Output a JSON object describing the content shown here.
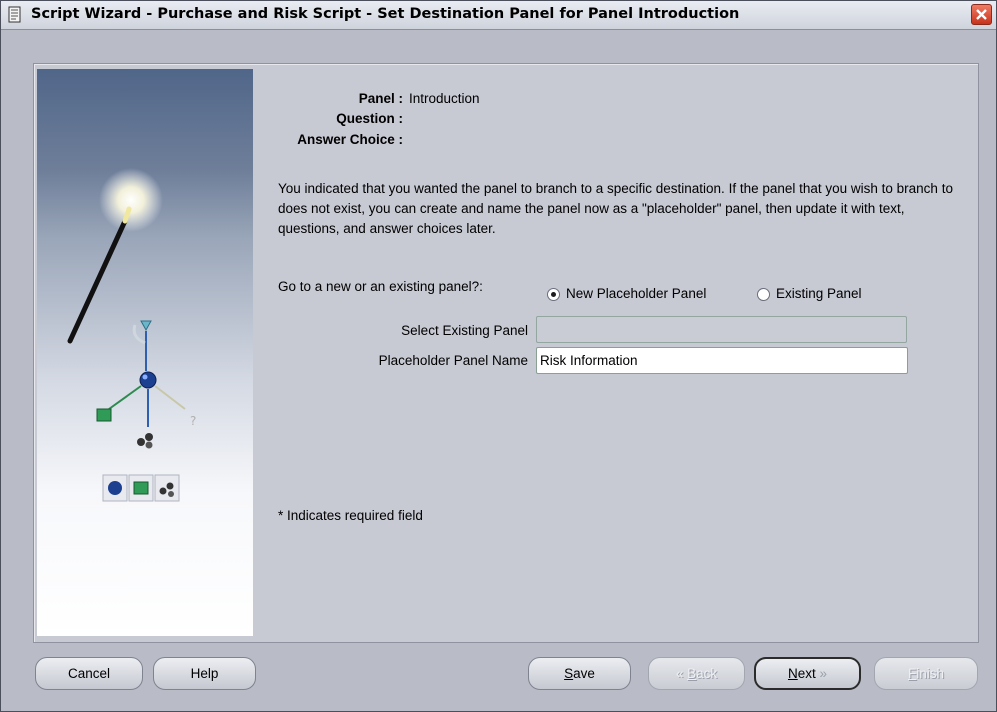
{
  "window": {
    "title": "Script Wizard - Purchase and Risk Script - Set Destination Panel for Panel Introduction"
  },
  "info": {
    "panel_label": "Panel :",
    "panel_value": "Introduction",
    "question_label": "Question :",
    "answer_choice_label": "Answer Choice :"
  },
  "description": "You indicated that you wanted the panel to branch to a specific destination. If the panel that you wish to branch to does not exist, you can create and name the panel now as a \"placeholder\" panel, then update it with text, questions, and answer choices later.",
  "destination": {
    "prompt": "Go to a new or an existing panel?:",
    "option_new": "New Placeholder Panel",
    "option_existing": "Existing Panel",
    "selected": "New Placeholder Panel"
  },
  "fields": {
    "select_existing_label": "Select Existing Panel",
    "select_existing_value": "",
    "placeholder_name_label": "Placeholder Panel Name",
    "placeholder_name_value": "Risk Information"
  },
  "required_note": "* Indicates required field",
  "buttons": {
    "cancel": "Cancel",
    "help": "Help",
    "save_u": "S",
    "save_rest": "ave",
    "back_u": "B",
    "back_rest": "ack",
    "next_u": "N",
    "next_rest": "ext",
    "finish_u": "F",
    "finish_rest": "inish"
  },
  "colors": {
    "dialog_bg": "#b9bcc6",
    "panel_bg": "#c7c9d3",
    "close_button": "#d9472c"
  },
  "icons": [
    "document-icon",
    "close-icon",
    "magic-wand-icon",
    "branch-diagram-icon",
    "chevron-left-icon",
    "chevron-right-icon"
  ]
}
